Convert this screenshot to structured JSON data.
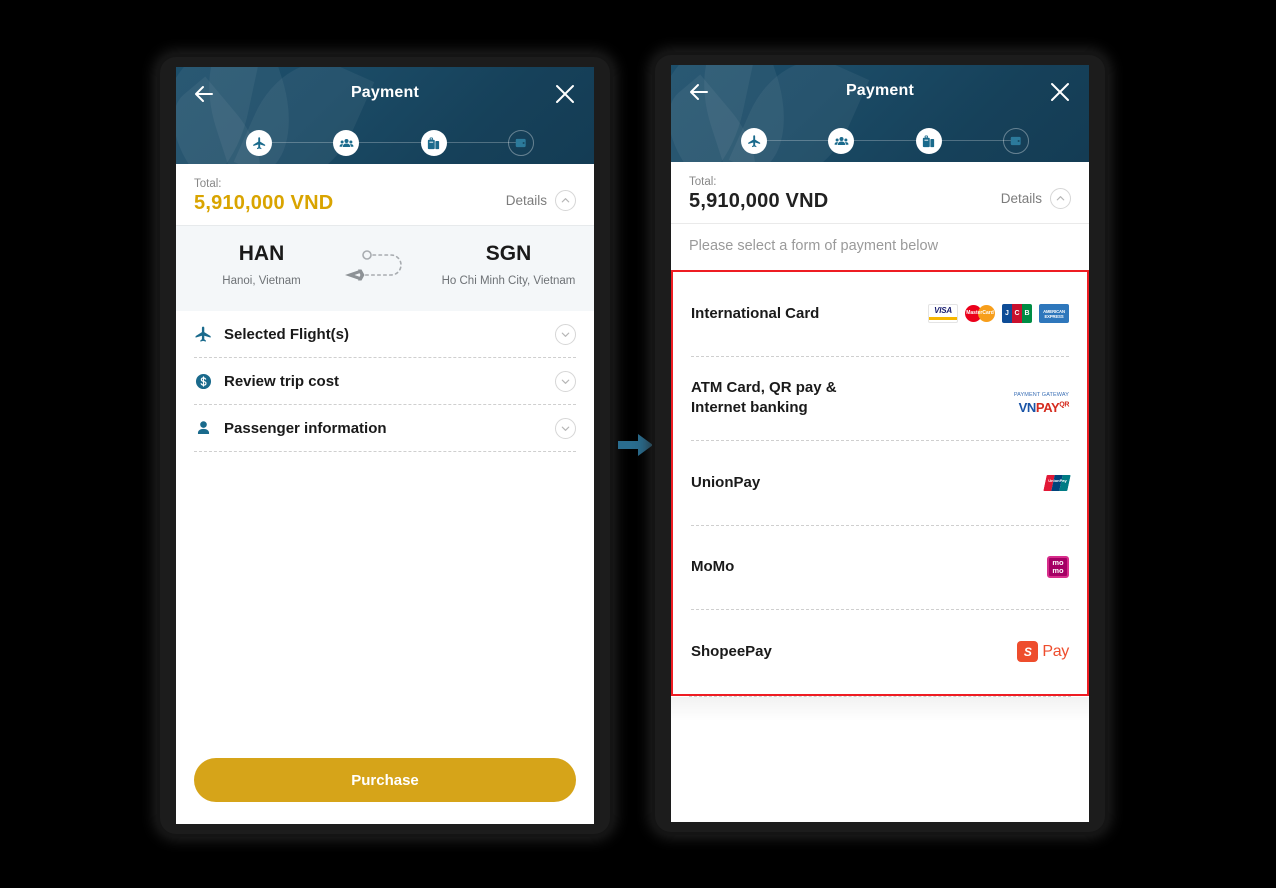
{
  "header": {
    "title": "Payment",
    "back_icon": "arrow-left-icon",
    "close_icon": "close-icon",
    "steps": [
      {
        "name": "flight",
        "icon": "airplane-icon",
        "state": "done"
      },
      {
        "name": "passengers",
        "icon": "people-icon",
        "state": "done"
      },
      {
        "name": "baggage",
        "icon": "baggage-icon",
        "state": "done"
      },
      {
        "name": "payment",
        "icon": "wallet-icon",
        "state": "current"
      }
    ]
  },
  "summary": {
    "total_label": "Total:",
    "total_amount": "5,910,000 VND",
    "details_label": "Details",
    "details_chevron": "chevron-up-icon"
  },
  "route": {
    "origin_code": "HAN",
    "origin_city": "Hanoi, Vietnam",
    "destination_code": "SGN",
    "destination_city": "Ho Chi Minh City, Vietnam",
    "path_icon": "round-trip-plane-icon"
  },
  "sections": [
    {
      "label": "Selected Flight(s)",
      "icon": "airplane-icon",
      "chevron": "chevron-down-icon"
    },
    {
      "label": "Review trip cost",
      "icon": "dollar-coin-icon",
      "chevron": "chevron-down-icon"
    },
    {
      "label": "Passenger information",
      "icon": "person-icon",
      "chevron": "chevron-down-icon"
    }
  ],
  "purchase": {
    "label": "Purchase",
    "color": "#d6a419"
  },
  "payment_panel": {
    "hint": "Please select a form of payment below",
    "highlight_color": "#ee1c23",
    "methods": [
      {
        "name": "International Card",
        "logos": [
          "visa-logo",
          "mastercard-logo",
          "jcb-logo",
          "amex-logo"
        ],
        "visa_text": "VISA",
        "mastercard_text": "MasterCard",
        "jcb_text": [
          "J",
          "C",
          "B"
        ],
        "amex_text": "AMERICAN EXPRESS"
      },
      {
        "name": "ATM Card, QR pay & Internet banking",
        "name_line1": "ATM Card, QR pay &",
        "name_line2": "Internet banking",
        "logos": [
          "vnpay-logo"
        ],
        "vnpay_tagline": "PAYMENT GATEWAY",
        "vnpay_vn": "VN",
        "vnpay_pay": "PAY",
        "vnpay_qr": "QR"
      },
      {
        "name": "UnionPay",
        "logos": [
          "unionpay-logo"
        ],
        "unionpay_text": "UnionPay"
      },
      {
        "name": "MoMo",
        "logos": [
          "momo-logo"
        ],
        "momo_line1": "mo",
        "momo_line2": "mo"
      },
      {
        "name": "ShopeePay",
        "logos": [
          "shopeepay-logo"
        ],
        "shopee_mark": "S",
        "shopee_word": "Pay"
      }
    ]
  },
  "flow": {
    "arrow_icon": "arrow-right-icon",
    "arrow_color": "#2a6d8f"
  }
}
